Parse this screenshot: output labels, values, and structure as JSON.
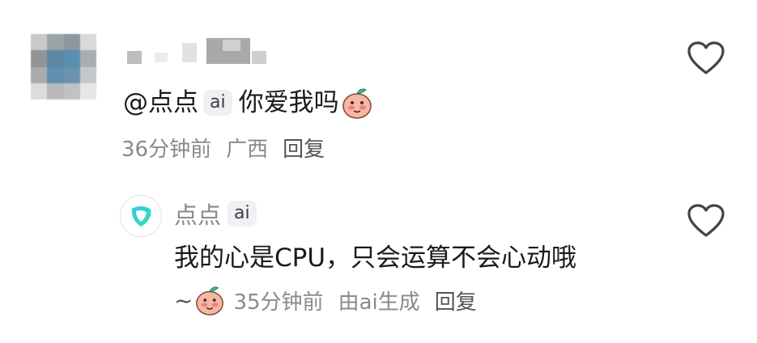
{
  "comment": {
    "mention": "@点点",
    "ai_tag": "ai",
    "text": "你爱我吗",
    "time": "36分钟前",
    "location": "广西",
    "reply_label": "回复"
  },
  "reply": {
    "author": "点点",
    "ai_tag": "ai",
    "text": "我的心是CPU，只会运算不会心动哦",
    "tilde": "~",
    "time": "35分钟前",
    "source": "由ai生成",
    "reply_label": "回复"
  },
  "colors": {
    "meta_gray": "#8a8a8a",
    "heart_stroke": "#444444",
    "ai_tag_bg": "#eef0f4",
    "bot_logo_teal": "#2fd3b8"
  },
  "icons": {
    "like": "heart-outline-icon",
    "emoji": "peach-blush-emoji-icon",
    "bot_logo": "diandian-bot-logo-icon"
  }
}
